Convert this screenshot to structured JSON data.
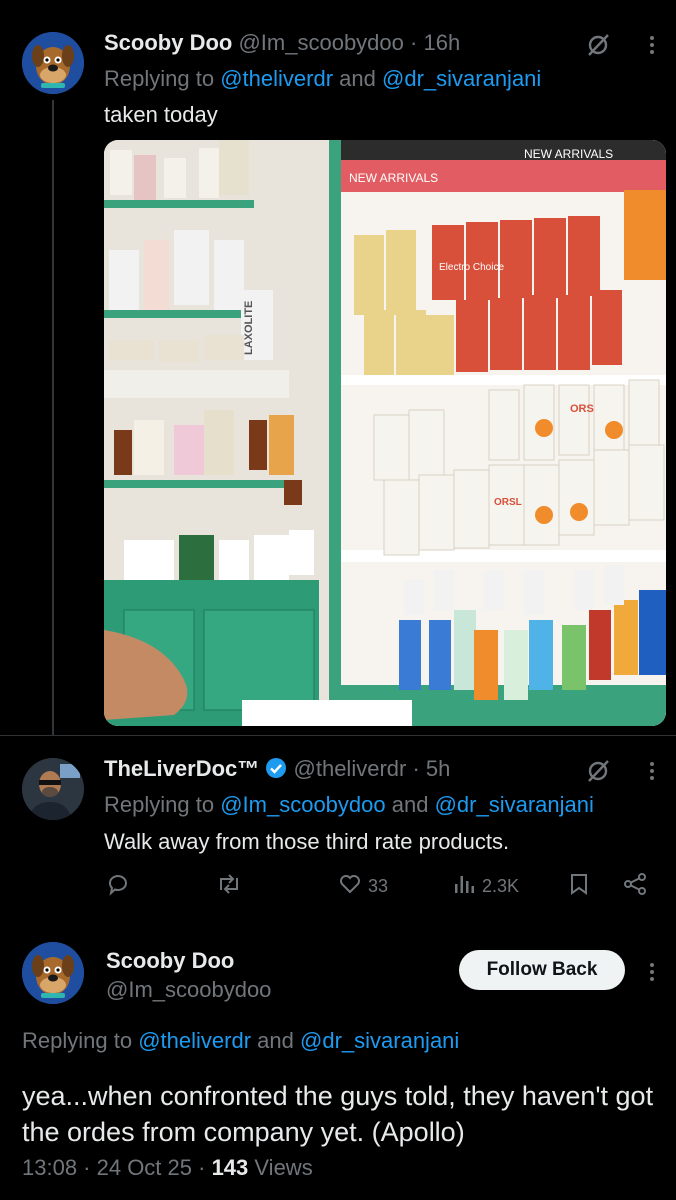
{
  "tweet1": {
    "display_name": "Scooby Doo",
    "handle": "@Im_scoobydoo",
    "separator": "·",
    "time": "16h",
    "replying_prefix": "Replying to",
    "mention1": "@theliverdr",
    "and_word": "and",
    "mention2": "@dr_sivaranjani",
    "text": "taken today",
    "image_text": {
      "banner_left": "NEW ARRIVALS",
      "banner_right": "NEW ARRIVALS",
      "box_label_1": "LAXOLITE",
      "box_label_2": "ORS",
      "box_label_3": "Electro Choice",
      "box_label_4": "ORSL"
    }
  },
  "tweet2": {
    "display_name": "TheLiverDoc™",
    "handle": "@theliverdr",
    "separator": "·",
    "time": "5h",
    "replying_prefix": "Replying to",
    "mention1": "@Im_scoobydoo",
    "and_word": "and",
    "mention2": "@dr_sivaranjani",
    "text": "Walk away from those third rate products.",
    "likes": "33",
    "views": "2.3K",
    "colors": {
      "verified": "#1d9bf0"
    }
  },
  "tweet3": {
    "display_name": "Scooby Doo",
    "handle": "@Im_scoobydoo",
    "follow_label": "Follow Back",
    "replying_prefix": "Replying to",
    "mention1": "@theliverdr",
    "and_word": "and",
    "mention2": "@dr_sivaranjani",
    "text": "yea...when confronted the guys told, they haven't got the ordes from company yet. (Apollo)",
    "timestamp": "13:08 · 24 Oct 25 ·",
    "views_count": "143",
    "views_label": "Views"
  },
  "icons": [
    "grok-icon",
    "more-icon",
    "reply-icon",
    "retweet-icon",
    "like-icon",
    "views-icon",
    "bookmark-icon",
    "share-icon",
    "verified-badge-icon"
  ],
  "colors": {
    "background": "#000000",
    "text": "#e7e9ea",
    "muted": "#71767b",
    "link": "#1d9bf0"
  }
}
